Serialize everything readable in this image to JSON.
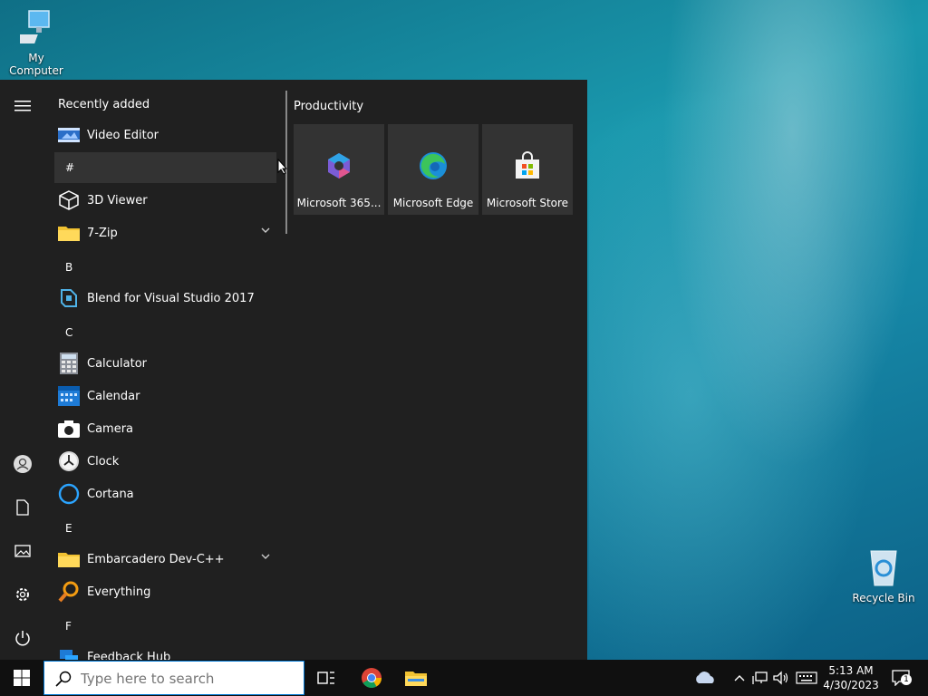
{
  "desktop": {
    "my_computer_label": "My Computer",
    "recycle_bin_label": "Recycle Bin"
  },
  "start_menu": {
    "recently_added_title": "Recently added",
    "apps": [
      {
        "kind": "app",
        "label": "Video Editor",
        "icon": "video-editor-icon"
      },
      {
        "kind": "letter",
        "label": "#"
      },
      {
        "kind": "app",
        "label": "3D Viewer",
        "icon": "3d-viewer-icon"
      },
      {
        "kind": "app",
        "label": "7-Zip",
        "icon": "folder-icon",
        "expandable": true
      },
      {
        "kind": "letter",
        "label": "B"
      },
      {
        "kind": "app",
        "label": "Blend for Visual Studio 2017",
        "icon": "blend-icon"
      },
      {
        "kind": "letter",
        "label": "C"
      },
      {
        "kind": "app",
        "label": "Calculator",
        "icon": "calculator-icon"
      },
      {
        "kind": "app",
        "label": "Calendar",
        "icon": "calendar-icon"
      },
      {
        "kind": "app",
        "label": "Camera",
        "icon": "camera-icon"
      },
      {
        "kind": "app",
        "label": "Clock",
        "icon": "clock-icon"
      },
      {
        "kind": "app",
        "label": "Cortana",
        "icon": "cortana-icon"
      },
      {
        "kind": "letter",
        "label": "E"
      },
      {
        "kind": "app",
        "label": "Embarcadero Dev-C++",
        "icon": "folder-icon",
        "expandable": true
      },
      {
        "kind": "app",
        "label": "Everything",
        "icon": "everything-icon"
      },
      {
        "kind": "letter",
        "label": "F"
      },
      {
        "kind": "app",
        "label": "Feedback Hub",
        "icon": "feedback-hub-icon"
      }
    ],
    "productivity_title": "Productivity",
    "tiles": [
      {
        "label": "Microsoft 365...",
        "icon": "microsoft-365-icon"
      },
      {
        "label": "Microsoft Edge",
        "icon": "edge-icon"
      },
      {
        "label": "Microsoft Store",
        "icon": "store-icon"
      }
    ]
  },
  "taskbar": {
    "search_placeholder": "Type here to search",
    "time": "5:13 AM",
    "date": "4/30/2023",
    "notification_count": "1"
  }
}
